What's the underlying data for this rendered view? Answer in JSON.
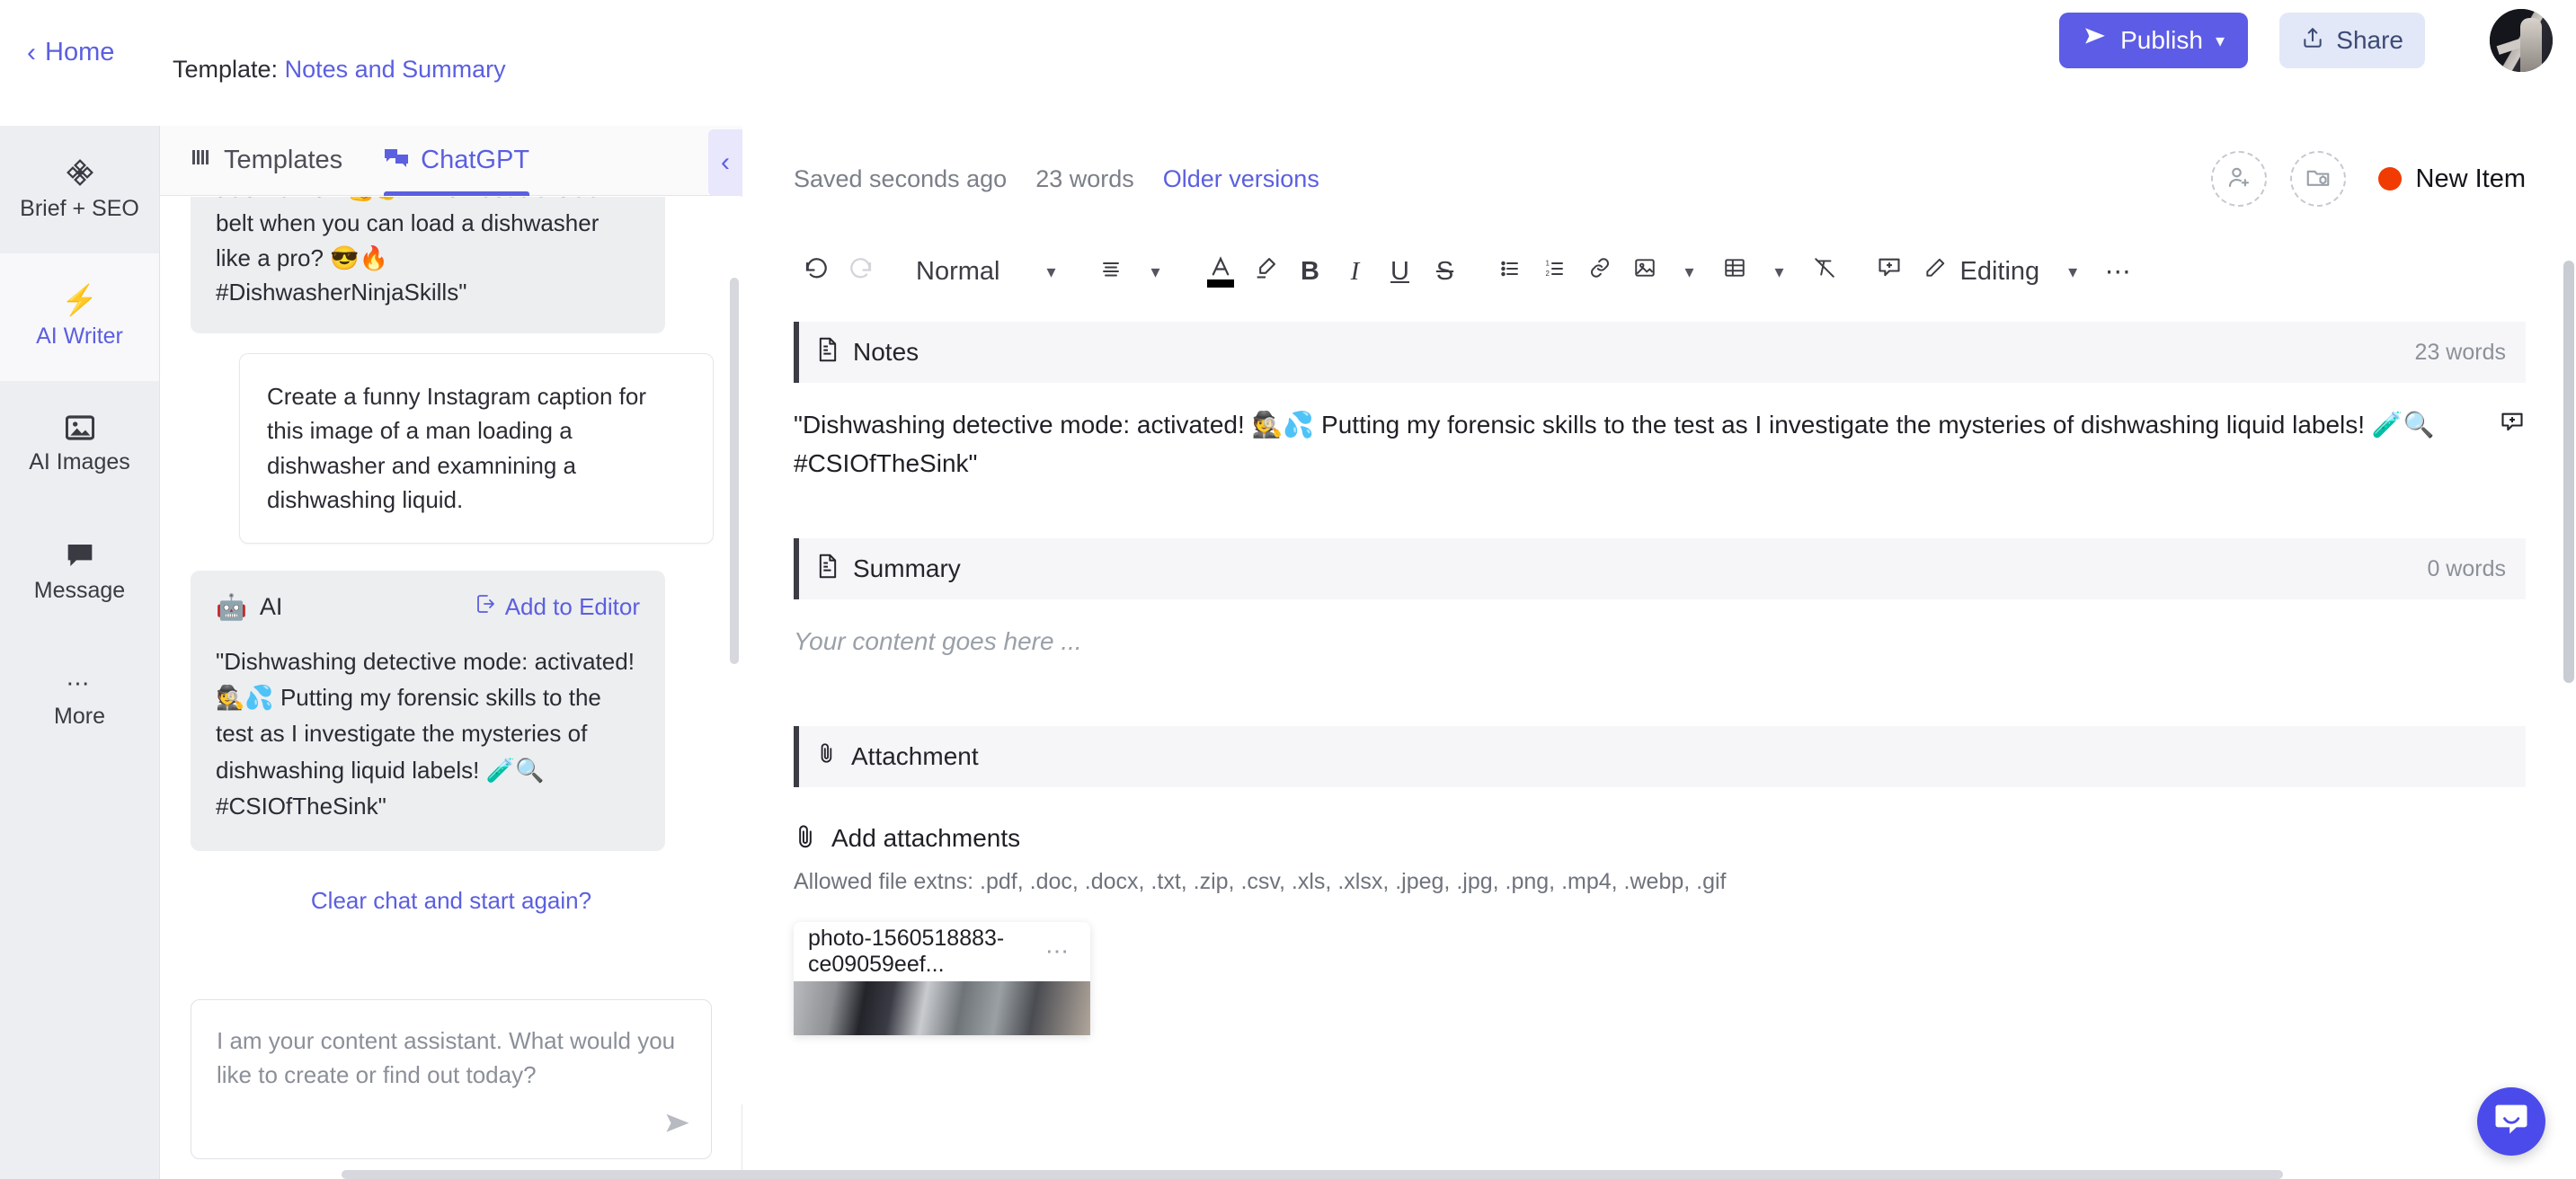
{
  "topbar": {
    "home_label": "Home",
    "back_icon": "chevron-left-icon",
    "template_prefix": "Template:",
    "template_name": "Notes and Summary",
    "publish_label": "Publish",
    "publish_icon": "send-icon",
    "publish_caret": "chevron-down-icon",
    "publish_color": "#5c5ce6",
    "share_label": "Share",
    "share_icon": "upload-icon",
    "avatar": "user-avatar"
  },
  "rail": {
    "items": [
      {
        "label": "Brief + SEO",
        "icon": "target-icon",
        "active": false
      },
      {
        "label": "AI Writer",
        "icon": "lightning-icon",
        "active": true
      },
      {
        "label": "AI Images",
        "icon": "image-icon",
        "active": false
      },
      {
        "label": "Message",
        "icon": "message-icon",
        "active": false
      },
      {
        "label": "More",
        "icon": "ellipsis-icon",
        "active": false
      }
    ]
  },
  "chat": {
    "tabs": [
      {
        "label": "Templates",
        "icon": "templates-icon",
        "active": false
      },
      {
        "label": "ChatGPT",
        "icon": "chat-bubbles-icon",
        "active": true
      }
    ],
    "collapse_icon": "chevron-left-icon",
    "messages": [
      {
        "role": "ai",
        "text": "true warrior! 💪🧽 Who needs a black belt when you can load a dishwasher like a pro? 😎🔥 #DishwasherNinjaSkills\""
      },
      {
        "role": "user",
        "text": "Create a funny Instagram caption for this image of a man loading a dishwasher and examnining a dishwashing liquid."
      },
      {
        "role": "ai-card",
        "sender": "AI",
        "sender_icon": "robot-icon",
        "add_to_editor": "Add to Editor",
        "add_to_editor_icon": "add-to-editor-icon",
        "text": "\"Dishwashing detective mode: activated! 🕵️💦 Putting my forensic skills to the test as I investigate the mysteries of dishwashing liquid labels! 🧪🔍 #CSIOfTheSink\""
      }
    ],
    "clear_chat_label": "Clear chat and start again?",
    "input_value": "",
    "input_placeholder": "I am your content assistant. What would you like to create or find out today?",
    "send_icon": "send-icon"
  },
  "editor": {
    "saved_label": "Saved seconds ago",
    "word_count": "23 words",
    "older_versions": "Older versions",
    "invite_icon": "add-user-icon",
    "folder_icon": "add-folder-icon",
    "status_label": "New Item",
    "status_color": "#f03c02",
    "toolbar": {
      "undo_icon": "undo-icon",
      "redo_icon": "redo-icon",
      "style_value": "Normal",
      "style_caret": "chevron-down-icon",
      "align_icon": "align-icon",
      "align_caret": "chevron-down-icon",
      "font_color_icon": "font-color-icon",
      "font_color_value": "#000000",
      "highlight_icon": "highlighter-icon",
      "bold_label": "B",
      "italic_label": "I",
      "underline_label": "U",
      "strike_label": "S",
      "bullet_list_icon": "bullet-list-icon",
      "numbered_list_icon": "numbered-list-icon",
      "link_icon": "link-icon",
      "image_icon": "image-icon",
      "image_caret": "chevron-down-icon",
      "table_icon": "table-icon",
      "table_caret": "chevron-down-icon",
      "clear_format_icon": "clear-format-icon",
      "comment_icon": "add-comment-icon",
      "mode_label": "Editing",
      "mode_icon": "pencil-icon",
      "mode_caret": "chevron-down-icon",
      "more_icon": "ellipsis-icon"
    },
    "sections": [
      {
        "title": "Notes",
        "icon": "document-icon",
        "words": "23 words",
        "body": "\"Dishwashing detective mode: activated! 🕵️💦 Putting my forensic skills to the test as I investigate the mysteries of dishwashing liquid labels! 🧪🔍 #CSIOfTheSink\"",
        "placeholder": false
      },
      {
        "title": "Summary",
        "icon": "document-icon",
        "words": "0 words",
        "body": "Your content goes here ...",
        "placeholder": true
      }
    ],
    "attachment": {
      "title": "Attachment",
      "icon": "paperclip-icon",
      "add_label": "Add attachments",
      "add_icon": "paperclip-icon",
      "allowed_label": "Allowed file extns: .pdf, .doc, .docx, .txt, .zip, .csv, .xls, .xlsx, .jpeg, .jpg, .png, .mp4, .webp, .gif",
      "file_name": "photo-1560518883-ce09059eef...",
      "file_menu_icon": "ellipsis-icon"
    }
  },
  "widget": {
    "icon": "intercom-chat-icon",
    "color": "#4b4beb"
  }
}
